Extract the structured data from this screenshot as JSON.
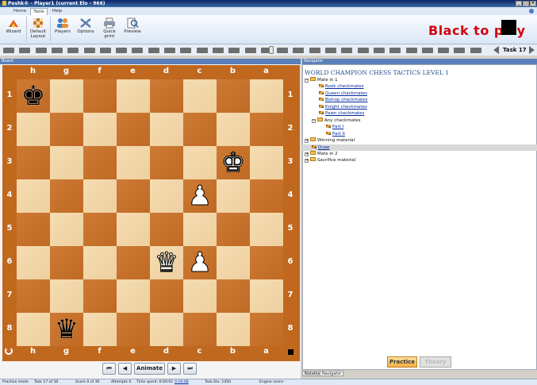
{
  "window": {
    "title": "Peshk® - Player1 (current Elo - 966)",
    "controls": [
      "_",
      "□",
      "×"
    ]
  },
  "menu": {
    "tabs": [
      "Home",
      "Tools",
      "Help"
    ],
    "active": "Tools"
  },
  "toolbar": {
    "buttons": [
      {
        "label": "Wizard",
        "icon": "wizard-icon"
      },
      {
        "label": "Default Layout",
        "icon": "layout-icon"
      },
      {
        "label": "Players",
        "icon": "players-icon"
      },
      {
        "label": "Options",
        "icon": "options-icon"
      },
      {
        "label": "Quick print",
        "icon": "printer-icon"
      },
      {
        "label": "Preview",
        "icon": "preview-icon"
      }
    ]
  },
  "status_banner": {
    "text": "Black to play",
    "side_color": "#000000"
  },
  "task_nav": {
    "label": "Task 17",
    "current": 17,
    "total": 30
  },
  "board_panel": {
    "title": "Board"
  },
  "board": {
    "files_top": [
      "h",
      "g",
      "f",
      "e",
      "d",
      "c",
      "b",
      "a"
    ],
    "files_bottom": [
      "h",
      "g",
      "f",
      "e",
      "d",
      "c",
      "b",
      "a"
    ],
    "ranks": [
      "1",
      "2",
      "3",
      "4",
      "5",
      "6",
      "7",
      "8"
    ],
    "colors": {
      "light": "#f2d6a8",
      "dark": "#c6702a",
      "frame": "#c0681e"
    },
    "pieces": [
      {
        "glyph": "♚",
        "color": "black",
        "file": "h",
        "rank": "1",
        "name": "black-king"
      },
      {
        "glyph": "♚",
        "color": "white",
        "file": "b",
        "rank": "3",
        "name": "white-king"
      },
      {
        "glyph": "♟",
        "color": "white",
        "file": "c",
        "rank": "4",
        "name": "white-pawn-c4"
      },
      {
        "glyph": "♛",
        "color": "white",
        "file": "d",
        "rank": "6",
        "name": "white-queen"
      },
      {
        "glyph": "♟",
        "color": "white",
        "file": "c",
        "rank": "6",
        "name": "white-pawn-c6"
      },
      {
        "glyph": "♛",
        "color": "black",
        "file": "g",
        "rank": "8",
        "name": "black-queen"
      }
    ]
  },
  "move_controls": {
    "first": "⏮",
    "back": "◀",
    "animate": "Animate",
    "forward": "▶",
    "last": "⏭"
  },
  "navigator": {
    "panel_title": "Navigator",
    "title": "WORLD CHAMPION CHESS TACTICS LEVEL 1",
    "tree": [
      {
        "label": "Mate in 1",
        "type": "folder",
        "expander": "−",
        "depth": 0,
        "link": false
      },
      {
        "label": "Rook checkmates",
        "type": "item",
        "depth": 1,
        "link": true
      },
      {
        "label": "Queen checkmates",
        "type": "item",
        "depth": 1,
        "link": true
      },
      {
        "label": "Bishop checkmates",
        "type": "item",
        "depth": 1,
        "link": true
      },
      {
        "label": "Knight checkmates",
        "type": "item",
        "depth": 1,
        "link": true
      },
      {
        "label": "Pawn checkmates",
        "type": "item",
        "depth": 1,
        "link": true
      },
      {
        "label": "Any checkmates",
        "type": "folder",
        "expander": "−",
        "depth": 1,
        "link": false
      },
      {
        "label": "Part I",
        "type": "item",
        "depth": 2,
        "link": true
      },
      {
        "label": "Part II",
        "type": "item",
        "depth": 2,
        "link": true
      },
      {
        "label": "Winning material",
        "type": "folder",
        "expander": "+",
        "depth": 0,
        "link": false
      },
      {
        "label": "Draw",
        "type": "item",
        "depth": 0,
        "link": true,
        "selected": true
      },
      {
        "label": "Mate in 2",
        "type": "folder",
        "expander": "+",
        "depth": 0,
        "link": false
      },
      {
        "label": "Sacrifice material",
        "type": "folder",
        "expander": "+",
        "depth": 0,
        "link": false
      }
    ]
  },
  "mode_buttons": {
    "practice": "Practice",
    "theory": "Theory"
  },
  "bottom_tabs": [
    "Notation",
    "Navigator"
  ],
  "status_bar": {
    "mode": "Practice mode",
    "task": "Task 17 of 30",
    "score": "Score 0 of 30",
    "attempts": "Attempts 0",
    "time_spent": "Time spent: 0:00:01",
    "time_link": "0:16:08",
    "task_elo": "Task Elo: 1450",
    "engine": "Engine score:"
  }
}
